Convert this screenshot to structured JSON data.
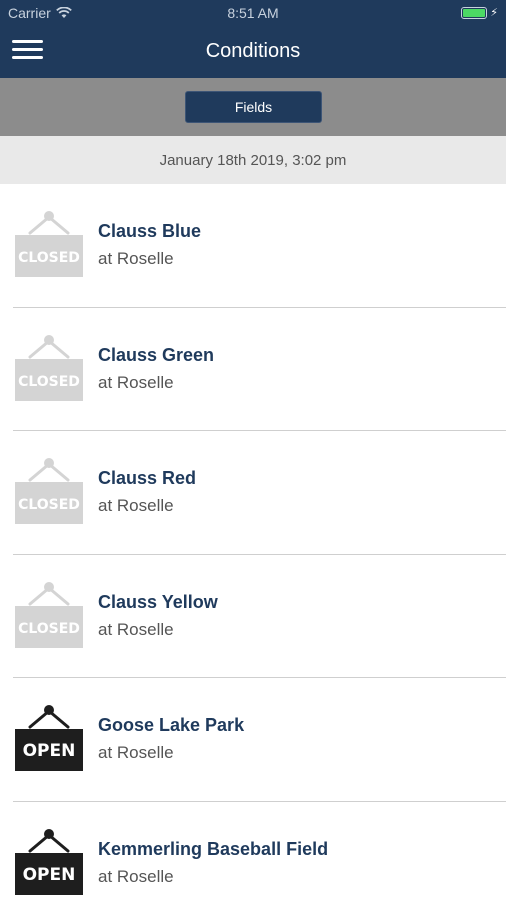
{
  "status_bar": {
    "carrier": "Carrier",
    "time": "8:51 AM"
  },
  "nav": {
    "title": "Conditions",
    "menu_icon": "hamburger-menu-icon"
  },
  "segment": {
    "label": "Fields"
  },
  "updated": "January 18th 2019, 3:02 pm",
  "fields": [
    {
      "name": "Clauss Blue",
      "location": "at Roselle",
      "status": "CLOSED"
    },
    {
      "name": "Clauss Green",
      "location": "at Roselle",
      "status": "CLOSED"
    },
    {
      "name": "Clauss Red",
      "location": "at Roselle",
      "status": "CLOSED"
    },
    {
      "name": "Clauss Yellow",
      "location": "at Roselle",
      "status": "CLOSED"
    },
    {
      "name": "Goose Lake Park",
      "location": "at Roselle",
      "status": "OPEN"
    },
    {
      "name": "Kemmerling Baseball Field",
      "location": "at Roselle",
      "status": "OPEN"
    }
  ],
  "colors": {
    "nav": "#1f3a5c",
    "closed_sign": "#d4d4d4",
    "open_sign": "#1e1e1e",
    "field_name": "#1f3a5c"
  }
}
